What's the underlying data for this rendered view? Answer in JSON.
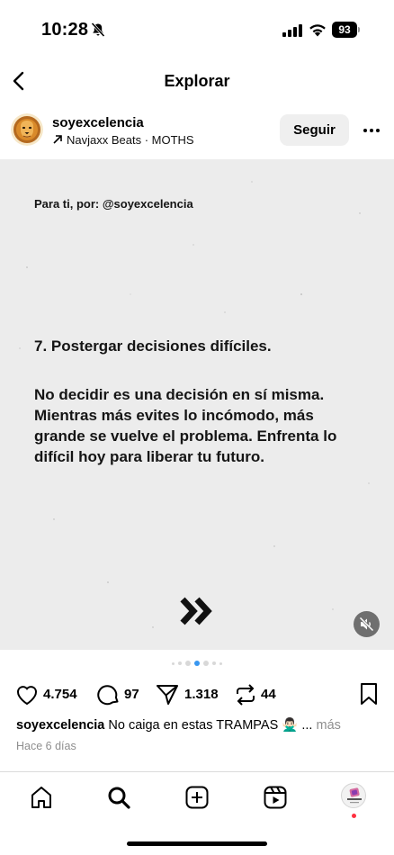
{
  "status_bar": {
    "time": "10:28",
    "battery": "93",
    "icons": [
      "bell-slash-icon",
      "signal-icon",
      "wifi-icon",
      "battery-icon"
    ]
  },
  "nav": {
    "title": "Explorar",
    "back_icon": "chevron-left-icon"
  },
  "post": {
    "username": "soyexcelencia",
    "audio": "Navjaxx Beats · MOTHS",
    "follow_label": "Seguir",
    "more_icon": "ellipsis-icon",
    "image": {
      "for_you": "Para ti, por: @soyexcelencia",
      "headline": "7. Postergar decisiones difíciles.",
      "body": "No decidir es una decisión en sí misma. Mientras más evites lo incómodo, más grande se vuelve el problema. Enfrenta lo difícil hoy para liberar tu futuro.",
      "next_icon": "double-chevron-right-icon",
      "mute_icon": "speaker-muted-icon"
    },
    "carousel": {
      "active_index": 3,
      "visible_dots": 7
    },
    "actions": {
      "likes": "4.754",
      "comments": "97",
      "shares": "1.318",
      "reposts": "44"
    },
    "caption": {
      "username": "soyexcelencia",
      "text": "No caiga en estas TRAMPAS 🙅🏻‍♂️ ...",
      "more": "más"
    },
    "timestamp": "Hace 6 días"
  },
  "tab_bar": {
    "items": [
      "home-icon",
      "search-icon",
      "create-icon",
      "reels-icon",
      "profile-avatar"
    ]
  },
  "colors": {
    "accent": "#3897f0",
    "notification": "#ff3040",
    "muted_text": "#8e8e8e",
    "button_bg": "#efefef",
    "image_bg": "#ececec"
  }
}
